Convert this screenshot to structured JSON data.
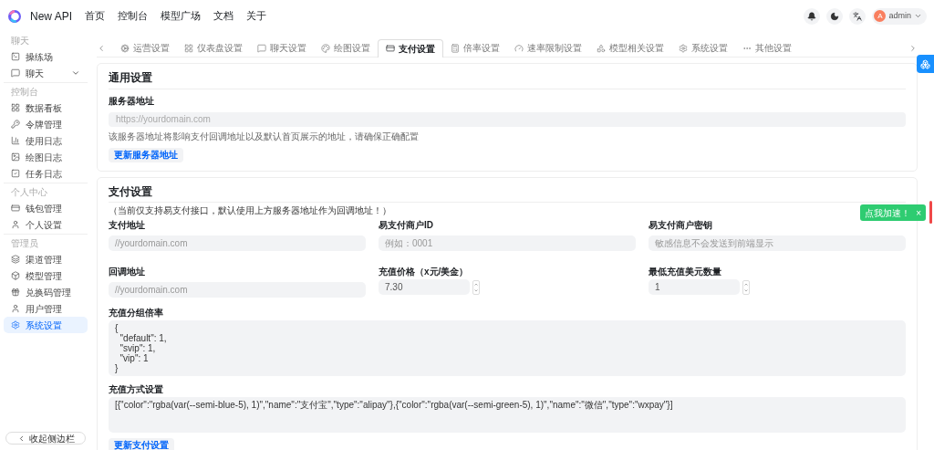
{
  "header": {
    "brand": "New API",
    "nav": [
      {
        "label": "首页"
      },
      {
        "label": "控制台"
      },
      {
        "label": "模型广场"
      },
      {
        "label": "文档"
      },
      {
        "label": "关于"
      }
    ],
    "user": {
      "avatar": "A",
      "name": "admin"
    }
  },
  "sidebar": {
    "groups": [
      {
        "title": "聊天",
        "items": [
          {
            "kind": "link",
            "label": "操练场",
            "selected": false
          },
          {
            "kind": "group",
            "label": "聊天",
            "selected": false
          }
        ]
      },
      {
        "title": "控制台",
        "items": [
          {
            "kind": "link",
            "label": "数据看板",
            "selected": false
          },
          {
            "kind": "link",
            "label": "令牌管理",
            "selected": false
          },
          {
            "kind": "link",
            "label": "使用日志",
            "selected": false
          },
          {
            "kind": "link",
            "label": "绘图日志",
            "selected": false
          },
          {
            "kind": "link",
            "label": "任务日志",
            "selected": false
          }
        ]
      },
      {
        "title": "个人中心",
        "items": [
          {
            "kind": "link",
            "label": "钱包管理",
            "selected": false
          },
          {
            "kind": "link",
            "label": "个人设置",
            "selected": false
          }
        ]
      },
      {
        "title": "管理员",
        "items": [
          {
            "kind": "link",
            "label": "渠道管理",
            "selected": false
          },
          {
            "kind": "link",
            "label": "模型管理",
            "selected": false
          },
          {
            "kind": "link",
            "label": "兑换码管理",
            "selected": false
          },
          {
            "kind": "link",
            "label": "用户管理",
            "selected": false
          },
          {
            "kind": "link",
            "label": "系统设置",
            "selected": true
          }
        ]
      }
    ],
    "collapse": "收起侧边栏"
  },
  "tabs": [
    {
      "label": "运营设置",
      "selected": false
    },
    {
      "label": "仪表盘设置",
      "selected": false
    },
    {
      "label": "聊天设置",
      "selected": false
    },
    {
      "label": "绘图设置",
      "selected": false
    },
    {
      "label": "支付设置",
      "selected": true
    },
    {
      "label": "倍率设置",
      "selected": false
    },
    {
      "label": "速率限制设置",
      "selected": false
    },
    {
      "label": "模型相关设置",
      "selected": false
    },
    {
      "label": "系统设置",
      "selected": false
    },
    {
      "label": "其他设置",
      "selected": false
    }
  ],
  "general": {
    "title": "通用设置",
    "field": {
      "label": "服务器地址",
      "placeholder": "https://yourdomain.com"
    },
    "hint": "该服务器地址将影响支付回调地址以及默认首页展示的地址，请确保正确配置",
    "button": "更新服务器地址"
  },
  "payment": {
    "title": "支付设置",
    "note": "（当前仅支持易支付接口，默认使用上方服务器地址作为回调地址！）",
    "fields": [
      {
        "kind": "text",
        "label": "支付地址",
        "placeholder": "//yourdomain.com"
      },
      {
        "kind": "text",
        "label": "易支付商户ID",
        "placeholder": "例如：0001"
      },
      {
        "kind": "text",
        "label": "易支付商户密钥",
        "placeholder": "敏感信息不会发送到前端显示"
      },
      {
        "kind": "text",
        "label": "回调地址",
        "placeholder": "//yourdomain.com"
      },
      {
        "kind": "number",
        "label": "充值价格（x元/美金）",
        "value": "7.30"
      },
      {
        "kind": "number",
        "label": "最低充值美元数量",
        "value": "1"
      }
    ],
    "textareas": [
      {
        "label": "充值分组倍率",
        "value": "{\n  \"default\": 1,\n  \"svip\": 1,\n  \"vip\": 1\n}"
      },
      {
        "label": "充值方式设置",
        "value": "[{\"color\":\"rgba(var(--semi-blue-5), 1)\",\"name\":\"支付宝\",\"type\":\"alipay\"},{\"color\":\"rgba(var(--semi-green-5), 1)\",\"name\":\"微信\",\"type\":\"wxpay\"}]"
      }
    ],
    "button": "更新支付设置"
  },
  "toast": {
    "text": "点我加速！",
    "close": "×"
  }
}
